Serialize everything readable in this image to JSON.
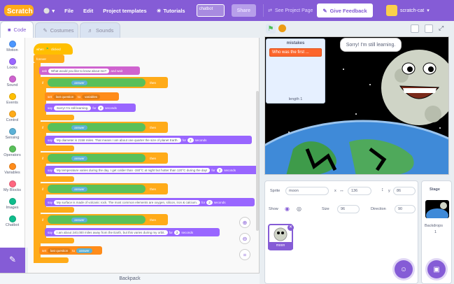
{
  "menubar": {
    "logo": "Scratch",
    "file": "File",
    "edit": "Edit",
    "templates": "Project templates",
    "tutorials": "Tutorials",
    "project_title": "chatbot",
    "share": "Share",
    "see_project": "See Project Page",
    "feedback": "Give Feedback",
    "username": "scratch-cat"
  },
  "tabs": {
    "code": "Code",
    "costumes": "Costumes",
    "sounds": "Sounds"
  },
  "categories": [
    {
      "label": "Motion",
      "color": "#4c97ff"
    },
    {
      "label": "Looks",
      "color": "#9966ff"
    },
    {
      "label": "Sound",
      "color": "#cf63cf"
    },
    {
      "label": "Events",
      "color": "#ffbf00"
    },
    {
      "label": "Control",
      "color": "#ffab19"
    },
    {
      "label": "Sensing",
      "color": "#5cb1d6"
    },
    {
      "label": "Operators",
      "color": "#59c059"
    },
    {
      "label": "Variables",
      "color": "#ff8c1a"
    },
    {
      "label": "My Blocks",
      "color": "#ff6680"
    },
    {
      "label": "Images",
      "color": "#0fbd8c"
    },
    {
      "label": "Chatbot",
      "color": "#0fbd8c"
    }
  ],
  "script": {
    "hat": "when",
    "hat2": "clicked",
    "forever": "forever",
    "ask": "ask",
    "ask_text": "What would you like to know about me?",
    "and_wait": "and wait",
    "if": "if",
    "then": "then",
    "answer": "answer",
    "set": "set",
    "last_question": "last question",
    "to": "to",
    "variables": "variables",
    "say": "say",
    "for": "for",
    "seconds": "seconds",
    "say1": "Sorry! I'm still learning.",
    "say2": "My diameter is 2158 miles. That means I am about one quarter the size of planet Earth.",
    "say3": "My temperature varies during the day. I get colder than -150°C at night but hotter than 120°C during the day!",
    "say4": "My surface is made of volcanic rock. The most common elements are oxygen, silicon, iron & calcium.",
    "say5": "I am about 240,000 miles away from the Earth, but this varies during my orbit.",
    "secs": "2"
  },
  "stage": {
    "list_name": "mistakes",
    "list_item": "Who was the first ...",
    "list_length": "length 1",
    "bubble": "Sorry! I'm still learning."
  },
  "sprite": {
    "label": "Sprite",
    "name": "moon",
    "x_label": "x",
    "x": "136",
    "y_label": "y",
    "y": "86",
    "show": "Show",
    "size_label": "Size",
    "size": "96",
    "direction_label": "Direction",
    "direction": "90",
    "thumb_name": "moon"
  },
  "stage_panel": {
    "title": "Stage",
    "backdrops": "Backdrops",
    "count": "1"
  },
  "backpack": "Backpack"
}
